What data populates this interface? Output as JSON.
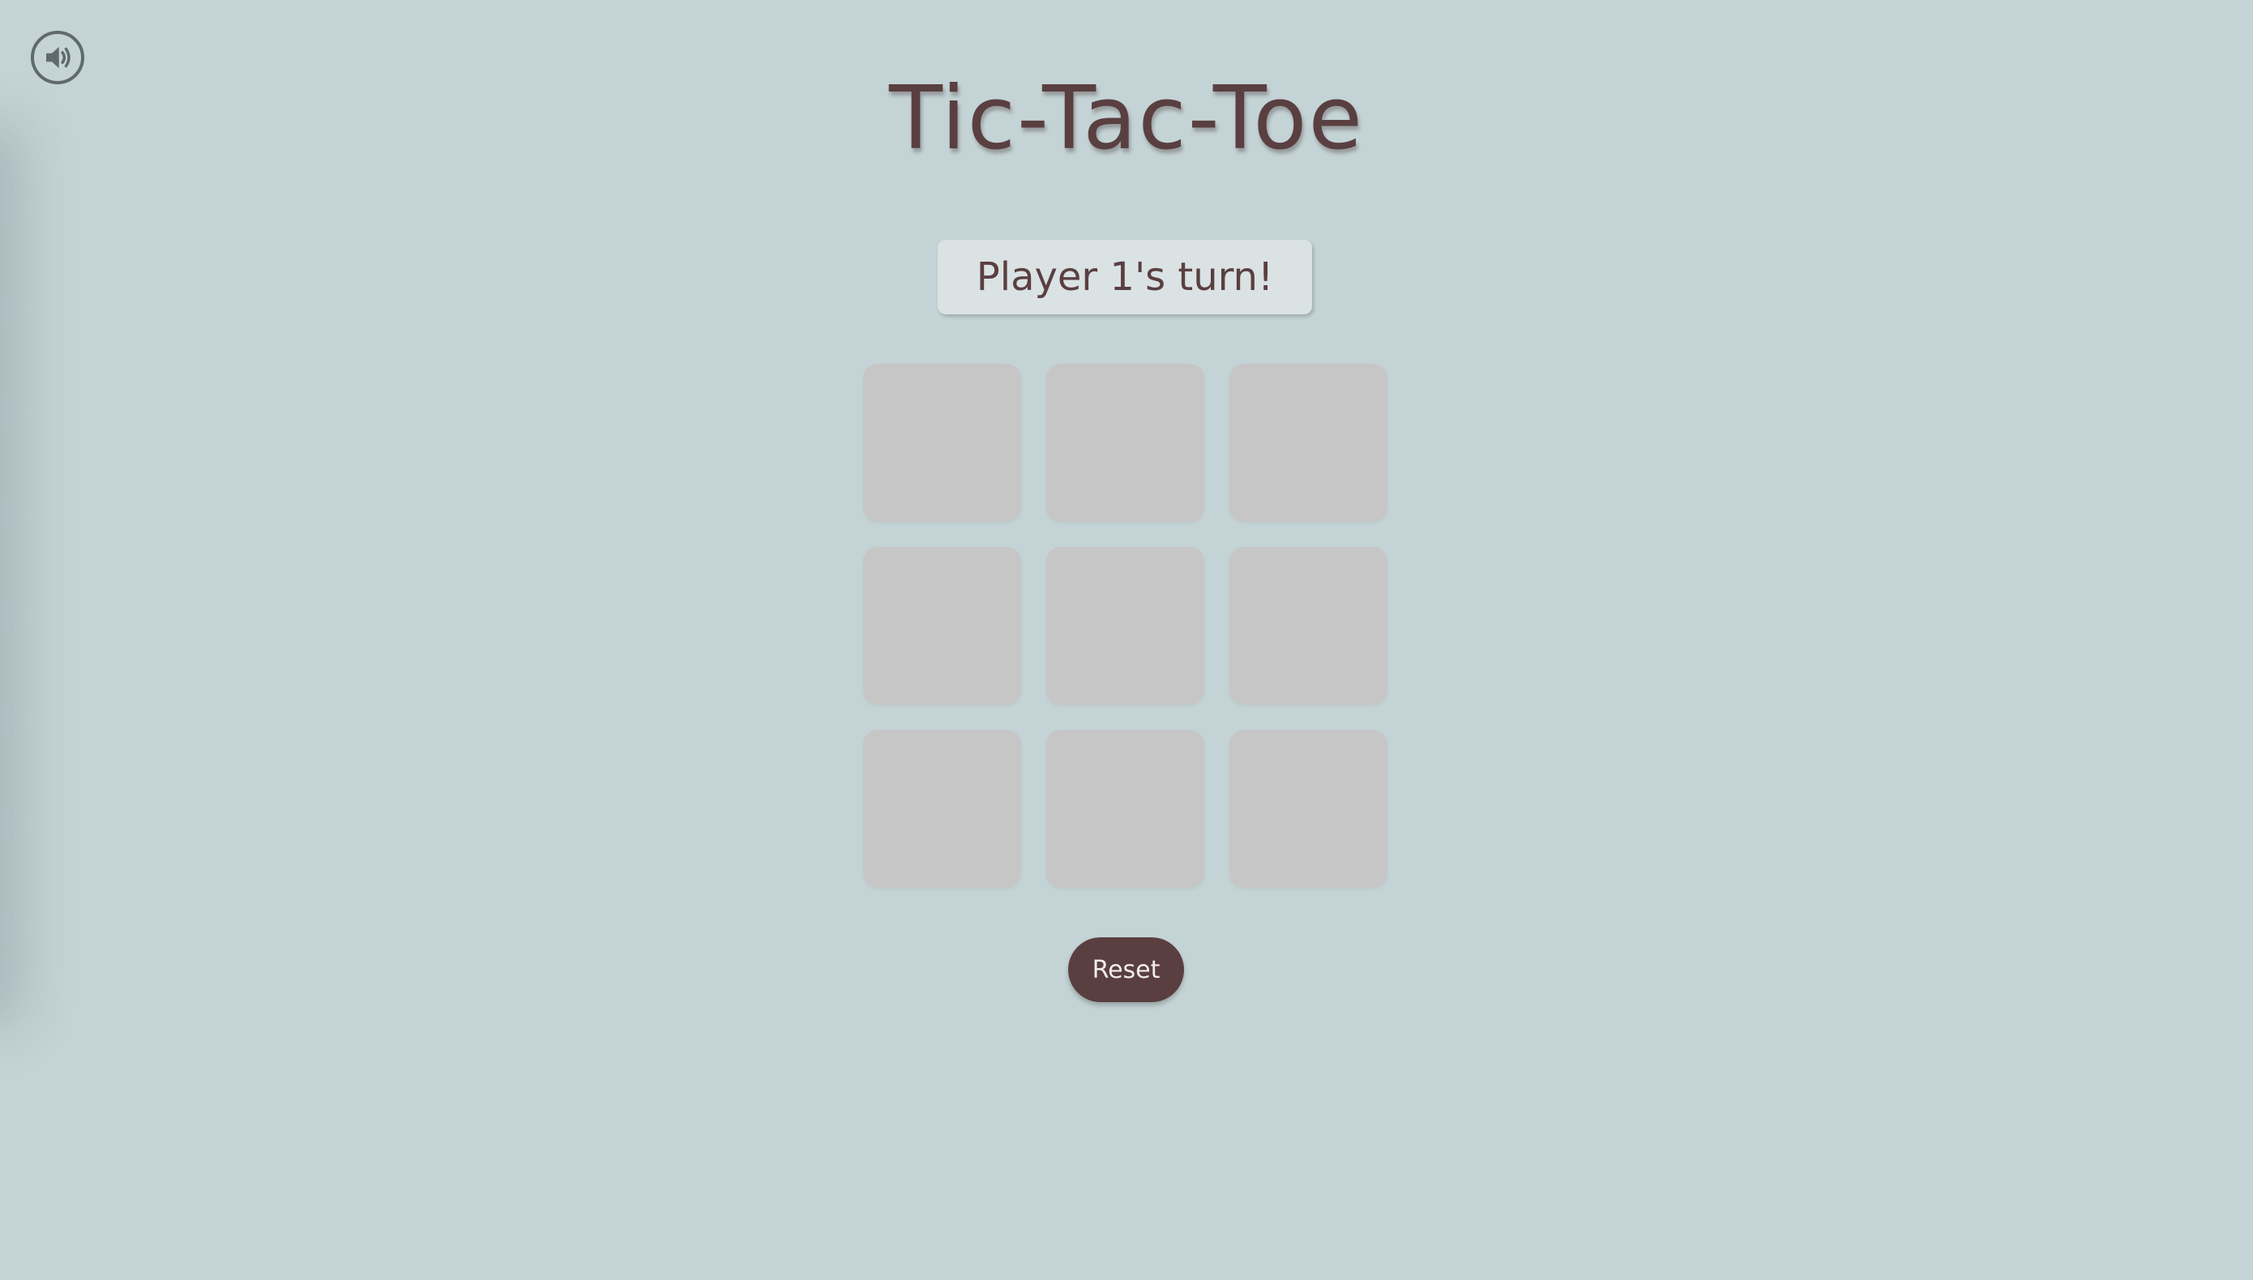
{
  "sound_button": {
    "icon": "speaker-volume-icon",
    "color": "#606a6c"
  },
  "title": "Tic-Tac-Toe",
  "status": {
    "turn_text": "Player 1's turn!"
  },
  "board": {
    "cells": [
      "",
      "",
      "",
      "",
      "",
      "",
      "",
      "",
      ""
    ],
    "cell_color": "#c6c6c6"
  },
  "reset_button": {
    "label": "Reset",
    "color": "#5a3f41"
  },
  "theme": {
    "background": "#c4d3d5",
    "text": "#5a3f41",
    "status_background": "#dae2e3"
  }
}
